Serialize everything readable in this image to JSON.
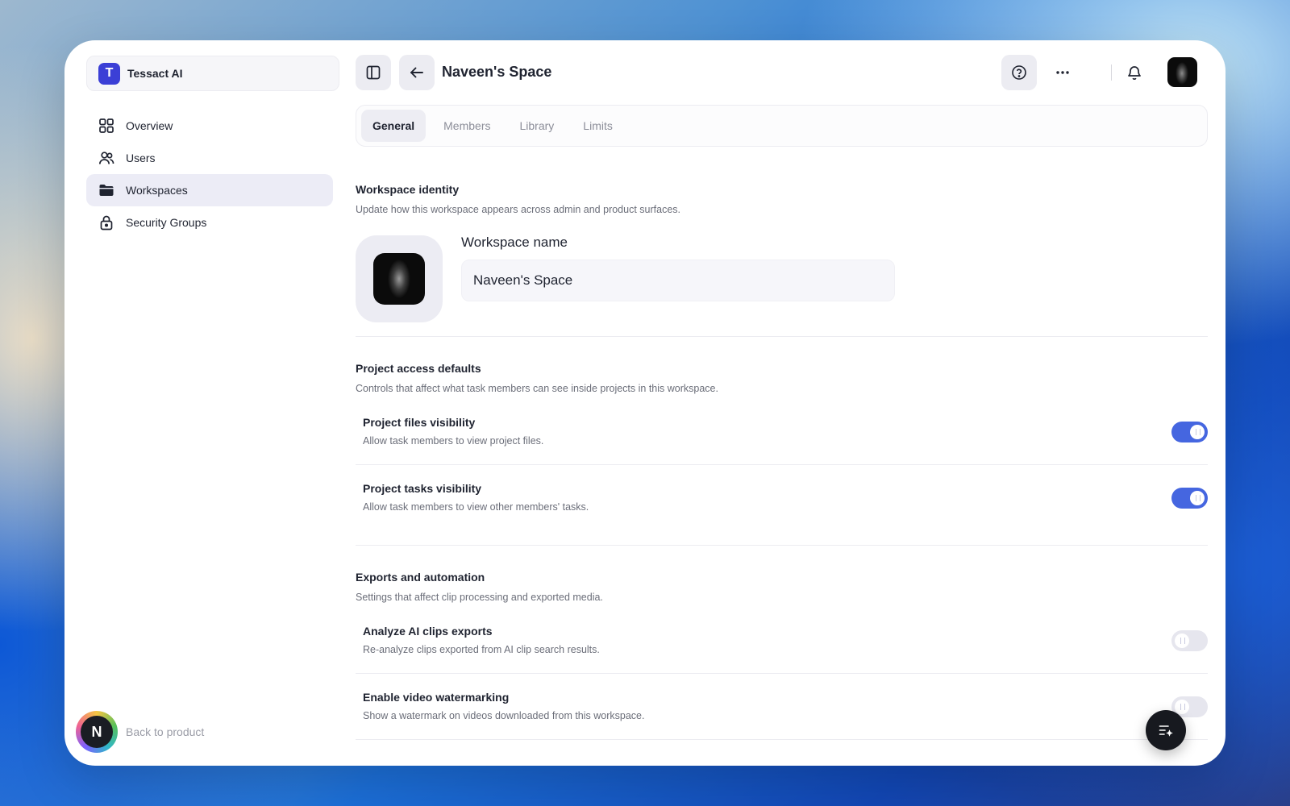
{
  "org": {
    "logo_letter": "T",
    "name": "Tessact AI"
  },
  "sidebar": {
    "items": [
      {
        "label": "Overview",
        "icon": "grid-icon"
      },
      {
        "label": "Users",
        "icon": "users-icon"
      },
      {
        "label": "Workspaces",
        "icon": "folder-icon",
        "active": true
      },
      {
        "label": "Security Groups",
        "icon": "lock-icon"
      }
    ],
    "back_label": "Back to product",
    "avatar_letter": "N"
  },
  "header": {
    "title": "Naveen's Space"
  },
  "tabs": [
    {
      "label": "General",
      "active": true
    },
    {
      "label": "Members"
    },
    {
      "label": "Library"
    },
    {
      "label": "Limits"
    }
  ],
  "identity": {
    "title": "Workspace identity",
    "desc": "Update how this workspace appears across admin and product surfaces.",
    "field_label": "Workspace name",
    "field_value": "Naveen's Space"
  },
  "access": {
    "title": "Project access defaults",
    "desc": "Controls that affect what task members can see inside projects in this workspace.",
    "rows": [
      {
        "title": "Project files visibility",
        "desc": "Allow task members to view project files.",
        "enabled": true
      },
      {
        "title": "Project tasks visibility",
        "desc": "Allow task members to view other members' tasks.",
        "enabled": true
      }
    ]
  },
  "exports": {
    "title": "Exports and automation",
    "desc": "Settings that affect clip processing and exported media.",
    "rows": [
      {
        "title": "Analyze AI clips exports",
        "desc": "Re-analyze clips exported from AI clip search results.",
        "enabled": false
      },
      {
        "title": "Enable video watermarking",
        "desc": "Show a watermark on videos downloaded from this workspace.",
        "enabled": false
      }
    ]
  },
  "colors": {
    "accent": "#4566e0",
    "brand": "#3b3fd6",
    "active_nav": "#ececf6"
  }
}
